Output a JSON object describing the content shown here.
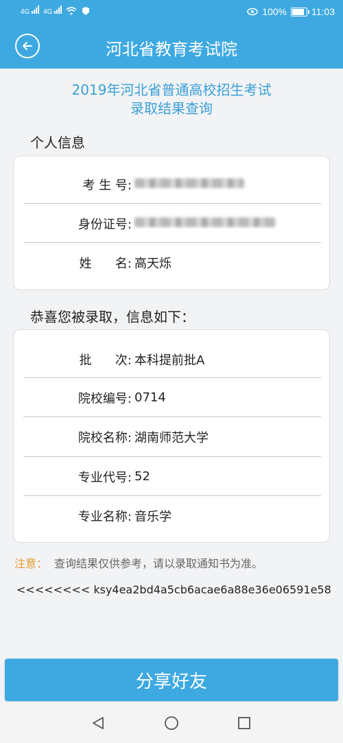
{
  "status_bar": {
    "signal1": "4G",
    "signal2": "4G",
    "battery": "100%",
    "time": "11:03",
    "battery_level": 1.0
  },
  "header": {
    "title": "河北省教育考试院"
  },
  "subtitle": {
    "line1": "2019年河北省普通高校招生考试",
    "line2": "录取结果查询"
  },
  "personal": {
    "section_label": "个人信息",
    "rows": [
      {
        "key": "考 生 号:",
        "value": ""
      },
      {
        "key": "身份证号:",
        "value": ""
      },
      {
        "key": "姓      名:",
        "value": "高天烁"
      }
    ]
  },
  "admission": {
    "section_label": "恭喜您被录取，信息如下：",
    "rows": [
      {
        "key": "批      次:",
        "value": "本科提前批A"
      },
      {
        "key": "院校编号:",
        "value": "0714"
      },
      {
        "key": "院校名称:",
        "value": "湖南师范大学"
      },
      {
        "key": "专业代号:",
        "value": "52"
      },
      {
        "key": "专业名称:",
        "value": "音乐学"
      }
    ]
  },
  "note": {
    "lead": "注意：",
    "text": "查询结果仅供参考，请以录取通知书为准。"
  },
  "hash_code": "<<<<<<<< ksy4ea2bd4a5cb6acae6a88e36e06591e58",
  "share_button": "分享好友",
  "colors": {
    "accent": "#3ea9e1",
    "subtitle": "#3aa0d6",
    "note_lead": "#e39a2a"
  }
}
